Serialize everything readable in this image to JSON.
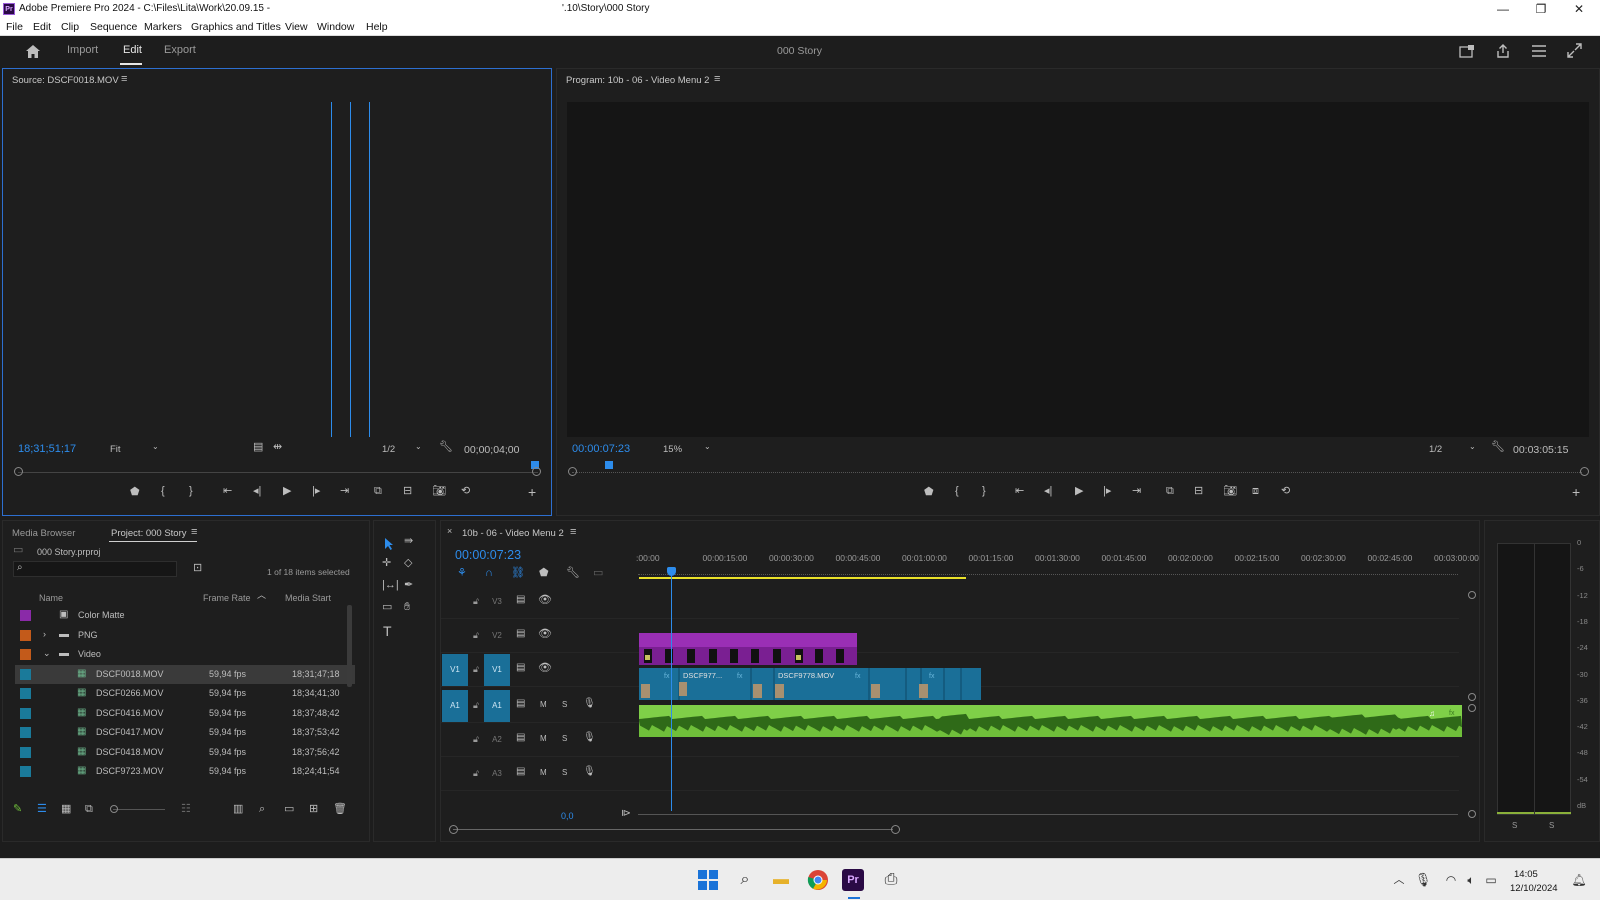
{
  "titlebar": {
    "app_title": "Adobe Premiere Pro 2024 - C:\\Files\\Lita\\Work\\20.09.15 -",
    "path_tail": "'.10\\Story\\000 Story",
    "minimize": "—",
    "maximize": "❐",
    "close": "✕"
  },
  "menu": [
    "File",
    "Edit",
    "Clip",
    "Sequence",
    "Markers",
    "Graphics and Titles",
    "View",
    "Window",
    "Help"
  ],
  "header": {
    "workspaces": [
      "Import",
      "Edit",
      "Export"
    ],
    "active_workspace": "Edit",
    "project_name": "000 Story"
  },
  "source_monitor": {
    "title": "Source: DSCF0018.MOV",
    "timecode": "18;31;51;17",
    "zoom": "Fit",
    "resolution": "1/2",
    "duration": "00;00;04;00"
  },
  "program_monitor": {
    "title": "Program: 10b - 06 - Video Menu 2",
    "timecode": "00:00:07:23",
    "zoom": "15%",
    "resolution": "1/2",
    "duration": "00:03:05:15"
  },
  "project_panel": {
    "tabs": [
      "Media Browser",
      "Project: 000 Story"
    ],
    "project_file": "000 Story.prproj",
    "selection_info": "1 of 18 items selected",
    "columns": [
      "Name",
      "Frame Rate",
      "Media Start"
    ],
    "items": [
      {
        "name": "Color Matte",
        "frame_rate": "",
        "media_start": "",
        "color": "#8a2aa8",
        "type": "matte",
        "indent": 0
      },
      {
        "name": "PNG",
        "frame_rate": "",
        "media_start": "",
        "color": "#c35a1a",
        "type": "folder",
        "indent": 0,
        "expander": ">"
      },
      {
        "name": "Video",
        "frame_rate": "",
        "media_start": "",
        "color": "#c35a1a",
        "type": "folder",
        "indent": 0,
        "expander": "v"
      },
      {
        "name": "DSCF0018.MOV",
        "frame_rate": "59,94 fps",
        "media_start": "18;31;47;18",
        "color": "#1a7a9a",
        "type": "clip",
        "indent": 1,
        "selected": true
      },
      {
        "name": "DSCF0266.MOV",
        "frame_rate": "59,94 fps",
        "media_start": "18;34;41;30",
        "color": "#1a7a9a",
        "type": "clip",
        "indent": 1
      },
      {
        "name": "DSCF0416.MOV",
        "frame_rate": "59,94 fps",
        "media_start": "18;37;48;42",
        "color": "#1a7a9a",
        "type": "clip",
        "indent": 1
      },
      {
        "name": "DSCF0417.MOV",
        "frame_rate": "59,94 fps",
        "media_start": "18;37;53;42",
        "color": "#1a7a9a",
        "type": "clip",
        "indent": 1
      },
      {
        "name": "DSCF0418.MOV",
        "frame_rate": "59,94 fps",
        "media_start": "18;37;56;42",
        "color": "#1a7a9a",
        "type": "clip",
        "indent": 1
      },
      {
        "name": "DSCF9723.MOV",
        "frame_rate": "59,94 fps",
        "media_start": "18;24;41;54",
        "color": "#1a7a9a",
        "type": "clip",
        "indent": 1
      }
    ]
  },
  "timeline": {
    "sequence_tab": "10b - 06 - Video Menu 2",
    "timecode": "00:00:07:23",
    "ruler": [
      ":00:00",
      "00:00:15:00",
      "00:00:30:00",
      "00:00:45:00",
      "00:01:00:00",
      "00:01:15:00",
      "00:01:30:00",
      "00:01:45:00",
      "00:02:00:00",
      "00:02:15:00",
      "00:02:30:00",
      "00:02:45:00",
      "00:03:00:00"
    ],
    "video_tracks": [
      "V3",
      "V2",
      "V1"
    ],
    "audio_tracks": [
      "A1",
      "A2",
      "A3"
    ],
    "clip_labels": [
      "DSCF977...",
      "DSCF9778.MOV"
    ],
    "mix_value": "0,0",
    "mute_label": "M",
    "solo_label": "S"
  },
  "audio_meter": {
    "scale": [
      "0",
      "-6",
      "-12",
      "-18",
      "-24",
      "-30",
      "-36",
      "-42",
      "-48",
      "-54",
      "dB"
    ],
    "solo_buttons": [
      "S",
      "S"
    ]
  },
  "taskbar": {
    "time": "14:05",
    "date": "12/10/2024"
  },
  "colors": {
    "accent_blue": "#2d8ceb",
    "video_clip": "#1a6f98",
    "v2_clip": "#9a2fb5",
    "audio_clip": "#6fbf3a",
    "work_area": "#e8e02a"
  }
}
